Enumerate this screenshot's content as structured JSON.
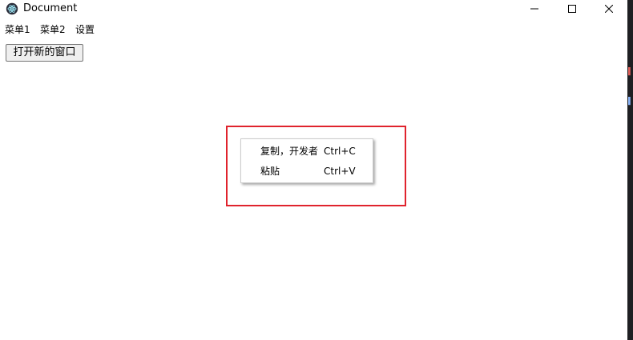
{
  "window": {
    "title": "Document",
    "controls": {
      "minimize_icon": "minimize-icon",
      "maximize_icon": "maximize-icon",
      "close_icon": "close-icon"
    }
  },
  "menubar": {
    "items": [
      {
        "label": "菜单1"
      },
      {
        "label": "菜单2"
      },
      {
        "label": "设置"
      }
    ]
  },
  "content": {
    "open_window_button": "打开新的窗口"
  },
  "context_menu": {
    "items": [
      {
        "label": "复制，开发者",
        "accelerator": "Ctrl+C"
      },
      {
        "label": "粘贴",
        "accelerator": "Ctrl+V"
      }
    ]
  },
  "colors": {
    "highlight_border": "#e0232d",
    "window_background": "#ffffff",
    "side_strip": "#1e1f22"
  }
}
